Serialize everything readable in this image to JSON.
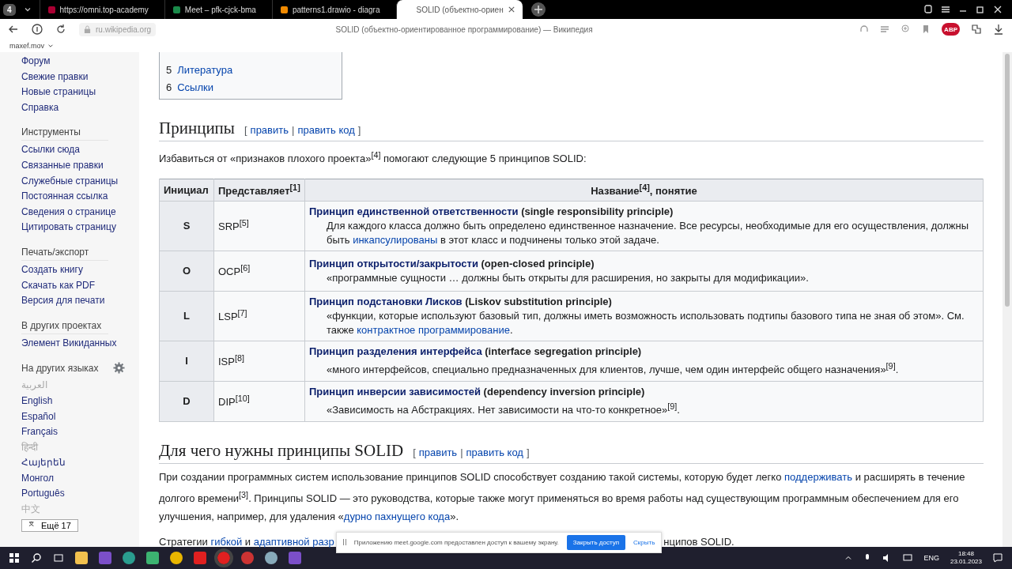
{
  "browser": {
    "tab_count": "4",
    "tabs": [
      {
        "title": "https://omni.top-academy",
        "selected": false
      },
      {
        "title": "Meet – pfk-cjck-bma",
        "selected": false
      },
      {
        "title": "patterns1.drawio - diagra",
        "selected": false
      },
      {
        "title": "SOLID (объектно-ориен",
        "selected": true
      }
    ],
    "url": "ru.wikipedia.org",
    "page_title": "SOLID (объектно-ориентированное программирование) — Википедия",
    "adblock_badge": "ABP",
    "bookmark": "maxef.mov"
  },
  "sidebar": {
    "groups": [
      {
        "items": [
          "Форум",
          "Свежие правки",
          "Новые страницы",
          "Справка"
        ]
      },
      {
        "heading": "Инструменты",
        "items": [
          "Ссылки сюда",
          "Связанные правки",
          "Служебные страницы",
          "Постоянная ссылка",
          "Сведения о странице",
          "Цитировать страницу"
        ]
      },
      {
        "heading": "Печать/экспорт",
        "items": [
          "Создать книгу",
          "Скачать как PDF",
          "Версия для печати"
        ]
      },
      {
        "heading": "В других проектах",
        "items": [
          "Элемент Викиданных"
        ]
      }
    ],
    "languages_heading": "На других языках",
    "languages": [
      {
        "label": "العربية",
        "faded": true
      },
      {
        "label": "English",
        "faded": false
      },
      {
        "label": "Español",
        "faded": false
      },
      {
        "label": "Français",
        "faded": false
      },
      {
        "label": "हिन्दी",
        "faded": true
      },
      {
        "label": "Հայերեն",
        "faded": false
      },
      {
        "label": "Монгол",
        "faded": false
      },
      {
        "label": "Português",
        "faded": false
      },
      {
        "label": "中文",
        "faded": true
      }
    ],
    "more_languages": "Ещё 17"
  },
  "toc": [
    {
      "number": "5",
      "label": "Литература"
    },
    {
      "number": "6",
      "label": "Ссылки"
    }
  ],
  "section1": {
    "title": "Принципы",
    "open": "[",
    "edit": "править",
    "separator": "|",
    "edit_code": "править код",
    "close": "]",
    "intro": "Избавиться от «признаков плохого проекта»$^{[4]}$ помогают следующие 5 принципов SOLID:"
  },
  "table": {
    "columns": [
      "Инициал",
      "Представляет$^{[1]}$",
      "Название$^{[4]}$, понятие"
    ],
    "rows": [
      {
        "initial": "S",
        "abbr": "SRP$^{[5]}$",
        "name": "Принцип единственной ответственности",
        "english": " (single responsibility principle)",
        "desc": [
          {
            "text": "Для каждого класса должно быть определено единственное назначение. Все ресурсы, необходимые для его осуществления, должны быть ",
            "link": false
          },
          {
            "text": "инкапсулированы",
            "link": true
          },
          {
            "text": " в этот класс и подчинены только этой задаче.",
            "link": false
          }
        ]
      },
      {
        "initial": "O",
        "abbr": "OCP$^{[6]}$",
        "name": "Принцип открытости/закрытости",
        "english": " (open-closed principle)",
        "desc": [
          {
            "text": "«программные сущности … должны быть открыты для расширения, но закрыты для модификации».",
            "link": false
          }
        ]
      },
      {
        "initial": "L",
        "abbr": "LSP$^{[7]}$",
        "name": "Принцип подстановки Лисков",
        "english": " (Liskov substitution principle)",
        "desc": [
          {
            "text": "«функции, которые используют базовый тип, должны иметь возможность использовать подтипы базового типа не зная об этом». См. также ",
            "link": false
          },
          {
            "text": "контрактное программирование",
            "link": true
          },
          {
            "text": ".",
            "link": false
          }
        ]
      },
      {
        "initial": "I",
        "abbr": "ISP$^{[8]}$",
        "name": "Принцип разделения интерфейса",
        "english": " (interface segregation principle)",
        "desc": [
          {
            "text": "«много интерфейсов, специально предназначенных для клиентов, лучше, чем один интерфейс общего назначения»$^{[9]}$.",
            "link": false
          }
        ]
      },
      {
        "initial": "D",
        "abbr": "DIP$^{[10]}$",
        "name": "Принцип инверсии зависимостей",
        "english": " (dependency inversion principle)",
        "desc": [
          {
            "text": "«Зависимость на Абстракциях. Нет зависимости на что-то конкретное»$^{[9]}$.",
            "link": false
          }
        ]
      }
    ]
  },
  "section2": {
    "title": "Для чего нужны принципы SOLID",
    "open": "[",
    "edit": "править",
    "separator": "|",
    "edit_code": "править код",
    "close": "]",
    "paragraph": [
      {
        "text": "При создании программных систем использование принципов SOLID способствует созданию такой системы, которую будет легко ",
        "link": false
      },
      {
        "text": "поддерживать",
        "link": true
      },
      {
        "text": " и расширять в течение долгого времени$^{[3]}$. Принципы SOLID — это руководства, которые также могут применяться во время работы над существующим программным обеспечением для его улучшения, например, для удаления «",
        "link": false
      },
      {
        "text": "дурно пахнущего кода",
        "link": true
      },
      {
        "text": "».",
        "link": false
      }
    ],
    "last_line_start": [
      {
        "text": "Стратегии ",
        "link": false
      },
      {
        "text": "гибкой",
        "link": true
      },
      {
        "text": " и ",
        "link": false
      },
      {
        "text": "адаптивной разр",
        "link": true
      }
    ],
    "last_line_end": "нципов SOLID."
  },
  "share_bar": {
    "message": "Приложению meet.google.com предоставлен доступ к вашему экрану.",
    "stop": "Закрыть доступ",
    "hide": "Скрыть"
  },
  "taskbar": {
    "language": "ENG",
    "time": "18:48",
    "date": "23.01.2023"
  }
}
